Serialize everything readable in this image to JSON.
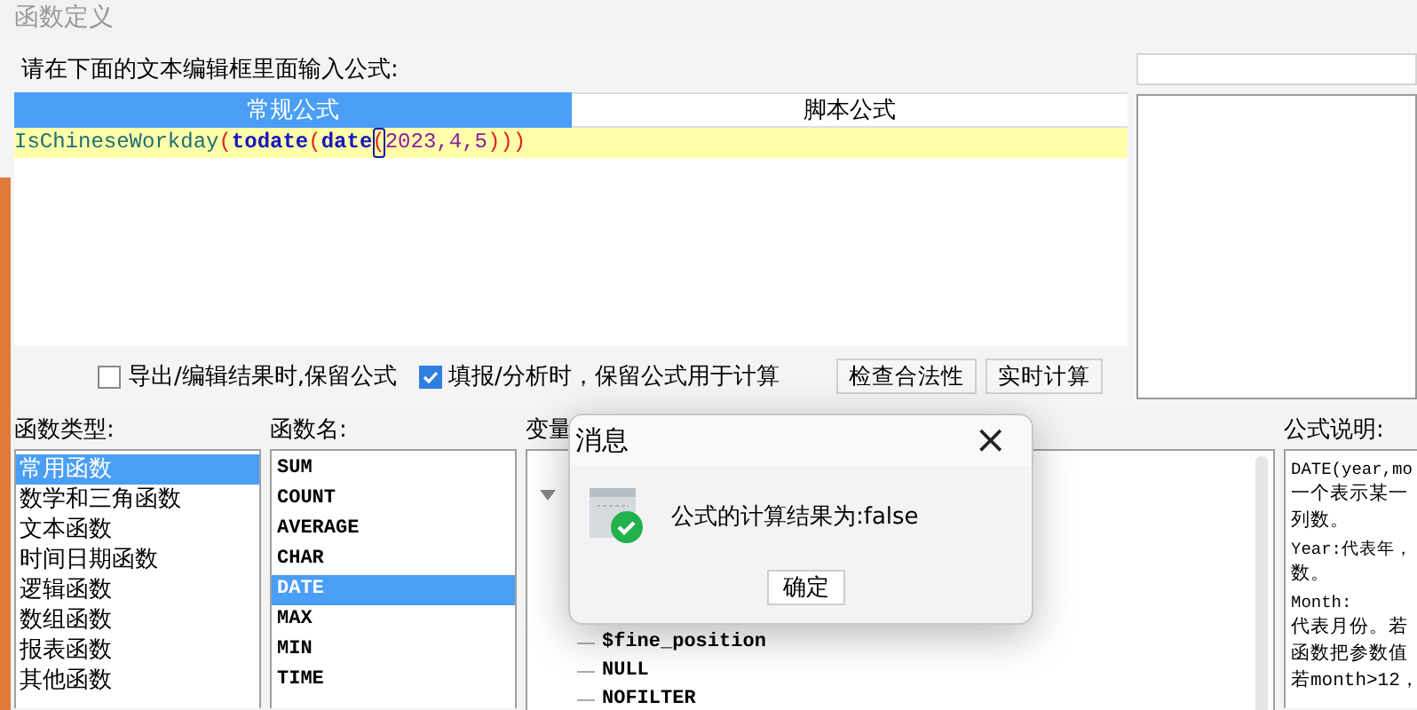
{
  "window": {
    "title": "函数定义"
  },
  "prompt": "请在下面的文本编辑框里面输入公式:",
  "tabs": [
    {
      "label": "常规公式",
      "selected": true
    },
    {
      "label": "脚本公式",
      "selected": false
    }
  ],
  "formula": [
    {
      "kind": "func",
      "text": "IsChineseWorkday"
    },
    {
      "kind": "paren",
      "text": "("
    },
    {
      "kind": "call",
      "text": "todate"
    },
    {
      "kind": "paren",
      "text": "("
    },
    {
      "kind": "call",
      "text": "date"
    },
    {
      "kind": "paren",
      "text": "(",
      "cursor": true
    },
    {
      "kind": "arg",
      "text": "2023,4,5"
    },
    {
      "kind": "paren",
      "text": ")))"
    }
  ],
  "options": [
    {
      "label": "导出/编辑结果时,保留公式",
      "checked": false
    },
    {
      "label": "填报/分析时，保留公式用于计算",
      "checked": true
    }
  ],
  "buttons": [
    "检查合法性",
    "实时计算"
  ],
  "function_types": {
    "label": "函数类型:",
    "items": [
      {
        "text": "常用函数",
        "selected": true
      },
      {
        "text": "数学和三角函数",
        "selected": false
      },
      {
        "text": "文本函数",
        "selected": false
      },
      {
        "text": "时间日期函数",
        "selected": false
      },
      {
        "text": "逻辑函数",
        "selected": false
      },
      {
        "text": "数组函数",
        "selected": false
      },
      {
        "text": "报表函数",
        "selected": false
      },
      {
        "text": "其他函数",
        "selected": false
      }
    ]
  },
  "function_names": {
    "label": "函数名:",
    "items": [
      {
        "text": "SUM",
        "selected": false
      },
      {
        "text": "COUNT",
        "selected": false
      },
      {
        "text": "AVERAGE",
        "selected": false
      },
      {
        "text": "CHAR",
        "selected": false
      },
      {
        "text": "DATE",
        "selected": true
      },
      {
        "text": "MAX",
        "selected": false
      },
      {
        "text": "MIN",
        "selected": false
      },
      {
        "text": "TIME",
        "selected": false
      }
    ]
  },
  "variables": {
    "label": "变量",
    "items": [
      "$fine_position",
      "NULL",
      "NOFILTER"
    ]
  },
  "description": {
    "label": "公式说明:",
    "lines": [
      "DATE(year,mo",
      "一个表示某一",
      "列数。",
      "Year:代表年，",
      "数。",
      "Month:",
      "代表月份。若",
      "函数把参数值",
      "若month>12，"
    ]
  },
  "dialog": {
    "title": "消息",
    "close": "×",
    "message": "公式的计算结果为:false",
    "button": "确定"
  }
}
